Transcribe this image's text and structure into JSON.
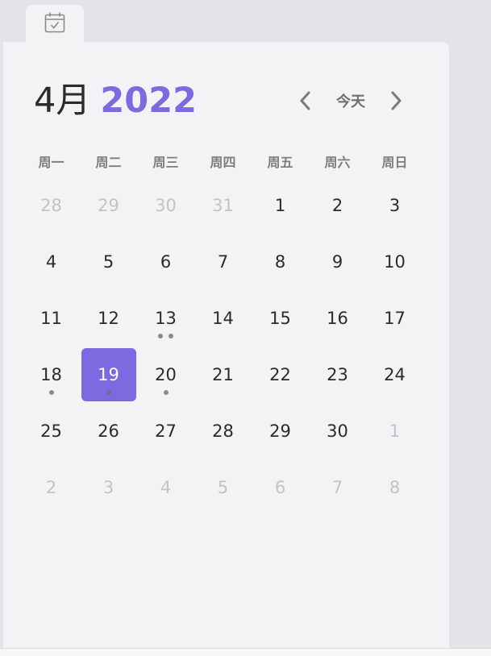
{
  "header": {
    "month_label": "4月",
    "year_label": "2022",
    "today_label": "今天"
  },
  "colors": {
    "accent": "#7b6ae0",
    "panel": "#f2f3f5",
    "muted_text": "#c3c3c6"
  },
  "icons": {
    "tab": "calendar-check-icon",
    "prev": "chevron-left-icon",
    "next": "chevron-right-icon"
  },
  "weekdays": [
    "周一",
    "周二",
    "周三",
    "周四",
    "周五",
    "周六",
    "周日"
  ],
  "weeks": [
    [
      {
        "day": "28",
        "muted": true,
        "dots": 0
      },
      {
        "day": "29",
        "muted": true,
        "dots": 0
      },
      {
        "day": "30",
        "muted": true,
        "dots": 0
      },
      {
        "day": "31",
        "muted": true,
        "dots": 0
      },
      {
        "day": "1",
        "muted": false,
        "dots": 0
      },
      {
        "day": "2",
        "muted": false,
        "dots": 0
      },
      {
        "day": "3",
        "muted": false,
        "dots": 0
      }
    ],
    [
      {
        "day": "4",
        "muted": false,
        "dots": 0
      },
      {
        "day": "5",
        "muted": false,
        "dots": 0
      },
      {
        "day": "6",
        "muted": false,
        "dots": 0
      },
      {
        "day": "7",
        "muted": false,
        "dots": 0
      },
      {
        "day": "8",
        "muted": false,
        "dots": 0
      },
      {
        "day": "9",
        "muted": false,
        "dots": 0
      },
      {
        "day": "10",
        "muted": false,
        "dots": 0
      }
    ],
    [
      {
        "day": "11",
        "muted": false,
        "dots": 0
      },
      {
        "day": "12",
        "muted": false,
        "dots": 0
      },
      {
        "day": "13",
        "muted": false,
        "dots": 2
      },
      {
        "day": "14",
        "muted": false,
        "dots": 0
      },
      {
        "day": "15",
        "muted": false,
        "dots": 0
      },
      {
        "day": "16",
        "muted": false,
        "dots": 0
      },
      {
        "day": "17",
        "muted": false,
        "dots": 0
      }
    ],
    [
      {
        "day": "18",
        "muted": false,
        "dots": 1
      },
      {
        "day": "19",
        "muted": false,
        "dots": 1,
        "selected": true
      },
      {
        "day": "20",
        "muted": false,
        "dots": 1
      },
      {
        "day": "21",
        "muted": false,
        "dots": 0
      },
      {
        "day": "22",
        "muted": false,
        "dots": 0
      },
      {
        "day": "23",
        "muted": false,
        "dots": 0
      },
      {
        "day": "24",
        "muted": false,
        "dots": 0
      }
    ],
    [
      {
        "day": "25",
        "muted": false,
        "dots": 0
      },
      {
        "day": "26",
        "muted": false,
        "dots": 0
      },
      {
        "day": "27",
        "muted": false,
        "dots": 0
      },
      {
        "day": "28",
        "muted": false,
        "dots": 0
      },
      {
        "day": "29",
        "muted": false,
        "dots": 0
      },
      {
        "day": "30",
        "muted": false,
        "dots": 0
      },
      {
        "day": "1",
        "muted": true,
        "dots": 0
      }
    ],
    [
      {
        "day": "2",
        "muted": true,
        "dots": 0
      },
      {
        "day": "3",
        "muted": true,
        "dots": 0
      },
      {
        "day": "4",
        "muted": true,
        "dots": 0
      },
      {
        "day": "5",
        "muted": true,
        "dots": 0
      },
      {
        "day": "6",
        "muted": true,
        "dots": 0
      },
      {
        "day": "7",
        "muted": true,
        "dots": 0
      },
      {
        "day": "8",
        "muted": true,
        "dots": 0
      }
    ]
  ]
}
